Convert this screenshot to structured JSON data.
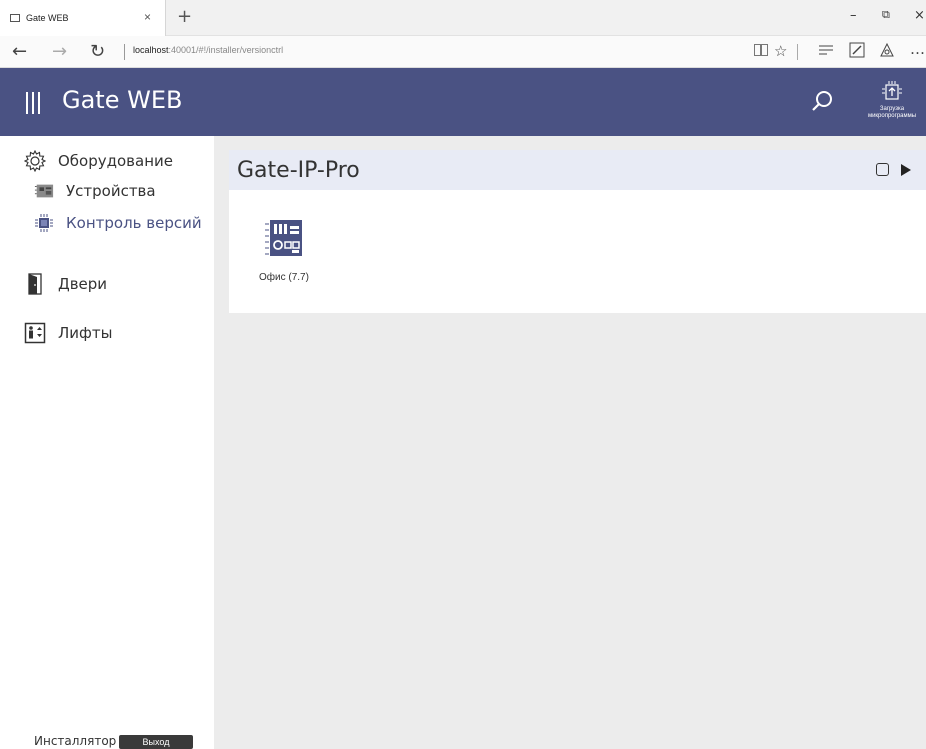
{
  "browser": {
    "tab_title": "Gate WEB",
    "tab_close": "×",
    "new_tab": "+",
    "url_host": "localhost",
    "url_rest": ":40001/#!/installer/versionctrl",
    "win_min": "–",
    "win_restore": "⧉",
    "win_close": "×",
    "back": "←",
    "forward": "→",
    "refresh": "↻",
    "more": "…"
  },
  "header": {
    "title": "Gate WEB",
    "firmware_label_line1": "Загрузка",
    "firmware_label_line2": "микропрограммы"
  },
  "sidebar": {
    "items": [
      {
        "label": "Оборудование",
        "icon": "gear-icon"
      },
      {
        "label": "Устройства",
        "icon": "device-board-icon"
      },
      {
        "label": "Контроль версий",
        "icon": "chip-icon"
      },
      {
        "label": "Двери",
        "icon": "door-icon"
      },
      {
        "label": "Лифты",
        "icon": "elevator-icon"
      }
    ],
    "footer": {
      "role": "Инсталлятор",
      "logout": "Выход"
    }
  },
  "main": {
    "panel_title": "Gate-IP-Pro",
    "devices": [
      {
        "label": "Офис (7.7)",
        "icon": "controller-board-icon"
      }
    ]
  },
  "colors": {
    "header_bg": "#4a5283",
    "main_bg": "#ececec",
    "panel_head_bg": "#e8ebf5",
    "active_item": "#4a5283"
  }
}
